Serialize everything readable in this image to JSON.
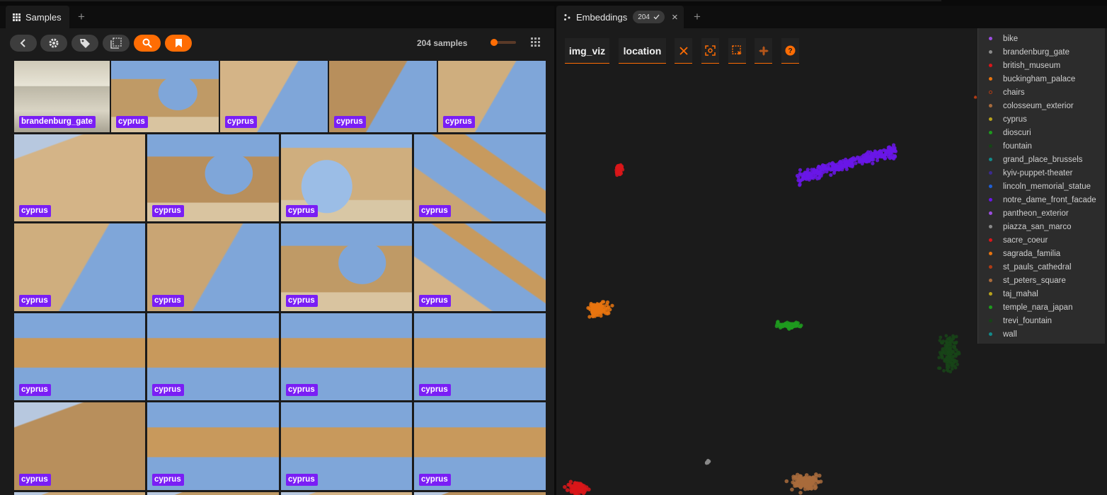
{
  "samples_tab": {
    "label": "Samples",
    "add": "+"
  },
  "embeddings_tab": {
    "label": "Embeddings",
    "count": "204",
    "close": "×",
    "add": "+"
  },
  "samples_toolbar": {
    "count_text": "204 samples"
  },
  "grid": {
    "tiles": [
      {
        "label": "brandenburg_gate",
        "scene": "gate"
      },
      {
        "label": "cyprus",
        "scene": "arch"
      },
      {
        "label": "cyprus",
        "scene": "wallsky"
      },
      {
        "label": "cyprus",
        "scene": "wallsky"
      },
      {
        "label": "cyprus",
        "scene": "wallsky"
      },
      {
        "label": "cyprus",
        "scene": "ruin"
      },
      {
        "label": "cyprus",
        "scene": "arch"
      },
      {
        "label": "cyprus",
        "scene": "bigarch"
      },
      {
        "label": "cyprus",
        "scene": "diag"
      },
      {
        "label": "cyprus",
        "scene": "wallsky"
      },
      {
        "label": "cyprus",
        "scene": "wallsky"
      },
      {
        "label": "cyprus",
        "scene": "arch"
      },
      {
        "label": "cyprus",
        "scene": "diag"
      },
      {
        "label": "cyprus",
        "scene": "beam"
      },
      {
        "label": "cyprus",
        "scene": "beam"
      },
      {
        "label": "cyprus",
        "scene": "beam"
      },
      {
        "label": "cyprus",
        "scene": "beam"
      },
      {
        "label": "cyprus",
        "scene": "ruin"
      },
      {
        "label": "cyprus",
        "scene": "beam"
      },
      {
        "label": "cyprus",
        "scene": "beam"
      },
      {
        "label": "cyprus",
        "scene": "beam"
      }
    ]
  },
  "embeddings_toolbar": {
    "field1": "img_viz",
    "field2": "location",
    "icons": [
      "clear-selection-icon",
      "fit-view-icon",
      "lasso-select-icon",
      "pan-icon",
      "help-icon"
    ]
  },
  "legend": {
    "items": [
      {
        "name": "bike",
        "color": "#9b4de0"
      },
      {
        "name": "brandenburg_gate",
        "color": "#8a8a8a"
      },
      {
        "name": "british_museum",
        "color": "#d9161a"
      },
      {
        "name": "buckingham_palace",
        "color": "#e8740f"
      },
      {
        "name": "chairs",
        "color": "#b23c15",
        "ring": true
      },
      {
        "name": "colosseum_exterior",
        "color": "#a86b3c"
      },
      {
        "name": "cyprus",
        "color": "#b8a21c"
      },
      {
        "name": "dioscuri",
        "color": "#1e9a1e"
      },
      {
        "name": "fountain",
        "color": "#174417"
      },
      {
        "name": "grand_place_brussels",
        "color": "#138a8a"
      },
      {
        "name": "kyiv-puppet-theater",
        "color": "#3b2a8f"
      },
      {
        "name": "lincoln_memorial_statue",
        "color": "#1f5fd6"
      },
      {
        "name": "notre_dame_front_facade",
        "color": "#6a16e8"
      },
      {
        "name": "pantheon_exterior",
        "color": "#9b4de0"
      },
      {
        "name": "piazza_san_marco",
        "color": "#8a8a8a"
      },
      {
        "name": "sacre_coeur",
        "color": "#d9161a"
      },
      {
        "name": "sagrada_familia",
        "color": "#e8740f"
      },
      {
        "name": "st_pauls_cathedral",
        "color": "#b23c15"
      },
      {
        "name": "st_peters_square",
        "color": "#a86b3c"
      },
      {
        "name": "taj_mahal",
        "color": "#b8a21c"
      },
      {
        "name": "temple_nara_japan",
        "color": "#1e9a1e"
      },
      {
        "name": "trevi_fountain",
        "color": "#174417"
      },
      {
        "name": "wall",
        "color": "#138a8a"
      }
    ]
  },
  "clusters": [
    {
      "label": "notre_dame_front_facade",
      "color": "#6a16e8",
      "shape": "wing"
    },
    {
      "label": "british_museum",
      "color": "#d9161a",
      "shape": "small"
    },
    {
      "label": "buckingham_palace",
      "color": "#e8740f",
      "shape": "blob"
    },
    {
      "label": "dioscuri",
      "color": "#1e9a1e",
      "shape": "flat"
    },
    {
      "label": "trevi_fountain",
      "color": "#174417",
      "shape": "tall"
    },
    {
      "label": "sacre_coeur",
      "color": "#d9161a",
      "shape": "blob"
    },
    {
      "label": "piazza_san_marco",
      "color": "#8a8a8a",
      "shape": "dash"
    },
    {
      "label": "colosseum_exterior",
      "color": "#a86b3c",
      "shape": "blob"
    },
    {
      "label": "chairs",
      "color": "#b23c15",
      "shape": "tiny"
    }
  ]
}
